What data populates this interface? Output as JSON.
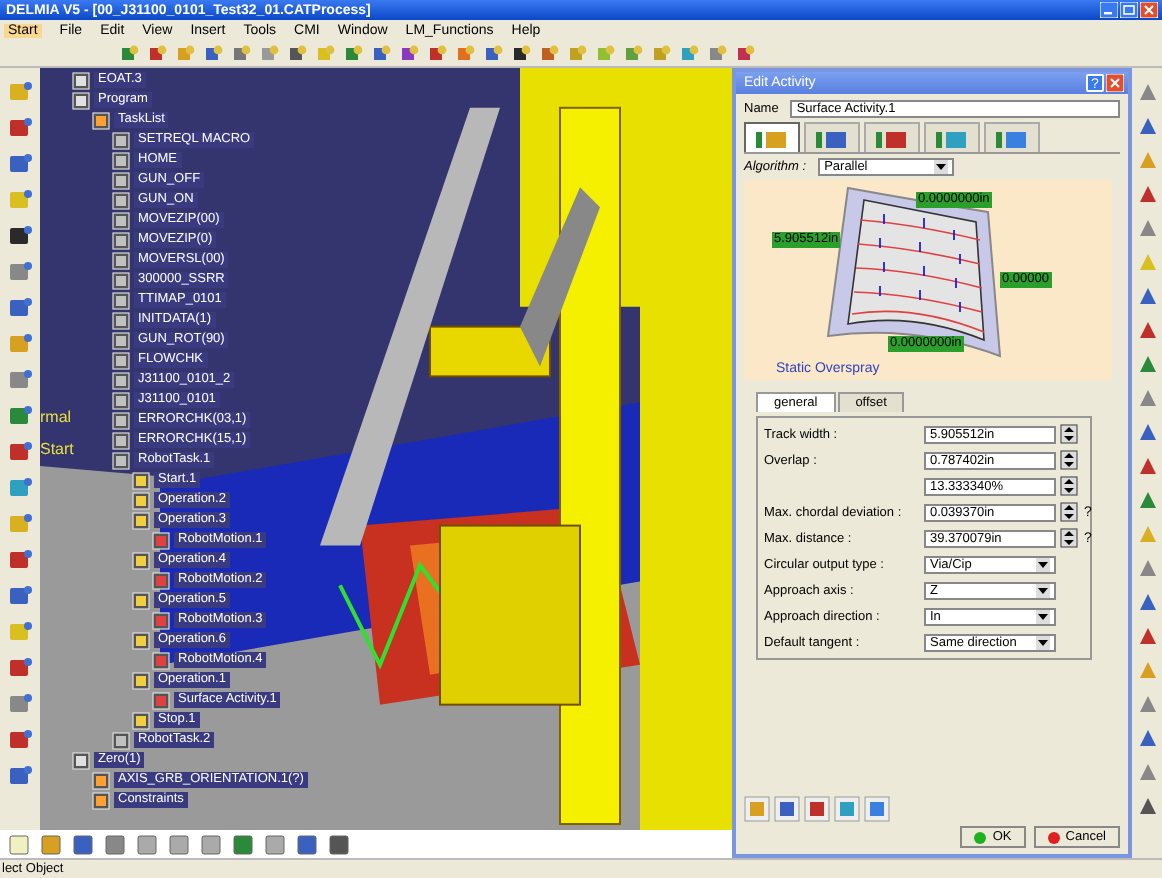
{
  "window": {
    "title": "DELMIA V5 - [00_J31100_0101_Test32_01.CATProcess]"
  },
  "menu": [
    {
      "label": "Start",
      "selected": true
    },
    {
      "label": "File",
      "selected": false
    },
    {
      "label": "Edit",
      "selected": false
    },
    {
      "label": "View",
      "selected": false
    },
    {
      "label": "Insert",
      "selected": false
    },
    {
      "label": "Tools",
      "selected": false
    },
    {
      "label": "CMI",
      "selected": false
    },
    {
      "label": "Window",
      "selected": false
    },
    {
      "label": "LM_Functions",
      "selected": false
    },
    {
      "label": "Help",
      "selected": false
    }
  ],
  "viewport_labels": [
    {
      "text": "rmal"
    },
    {
      "text": "Start"
    }
  ],
  "tree": [
    {
      "label": "EOAT.3"
    },
    {
      "label": "Program",
      "children": [
        {
          "label": "TaskList",
          "children": [
            {
              "label": "SETREQL MACRO"
            },
            {
              "label": "HOME"
            },
            {
              "label": "GUN_OFF"
            },
            {
              "label": "GUN_ON"
            },
            {
              "label": "MOVEZIP(00)"
            },
            {
              "label": "MOVEZIP(0)"
            },
            {
              "label": "MOVERSL(00)"
            },
            {
              "label": "300000_SSRR"
            },
            {
              "label": "TTIMAP_0101"
            },
            {
              "label": "INITDATA(1)"
            },
            {
              "label": "GUN_ROT(90)"
            },
            {
              "label": "FLOWCHK"
            },
            {
              "label": "J31100_0101_2"
            },
            {
              "label": "J31100_0101"
            },
            {
              "label": "ERRORCHK(03,1)"
            },
            {
              "label": "ERRORCHK(15,1)"
            },
            {
              "label": "RobotTask.1",
              "children": [
                {
                  "label": "Start.1"
                },
                {
                  "label": "Operation.2"
                },
                {
                  "label": "Operation.3",
                  "children": [
                    {
                      "label": "RobotMotion.1"
                    }
                  ]
                },
                {
                  "label": "Operation.4",
                  "children": [
                    {
                      "label": "RobotMotion.2"
                    }
                  ]
                },
                {
                  "label": "Operation.5",
                  "children": [
                    {
                      "label": "RobotMotion.3"
                    }
                  ]
                },
                {
                  "label": "Operation.6",
                  "children": [
                    {
                      "label": "RobotMotion.4"
                    }
                  ]
                },
                {
                  "label": "Operation.1",
                  "children": [
                    {
                      "label": "Surface Activity.1"
                    }
                  ]
                },
                {
                  "label": "Stop.1"
                }
              ]
            },
            {
              "label": "RobotTask.2"
            }
          ]
        }
      ]
    },
    {
      "label": "Zero(1)",
      "children": [
        {
          "label": "AXIS_GRB_ORIENTATION.1(?)"
        },
        {
          "label": "Constraints"
        }
      ]
    }
  ],
  "dialog": {
    "title": "Edit Activity",
    "help_button": "?",
    "name_label": "Name",
    "name_value": "Surface Activity.1",
    "icon_tabs": [
      {
        "selected": true
      },
      {
        "selected": false
      },
      {
        "selected": false
      },
      {
        "selected": false
      },
      {
        "selected": false
      }
    ],
    "algorithm_label": "Algorithm :",
    "algorithm_value": "Parallel",
    "diagram_labels": [
      "0.0000000in",
      "5.905512in",
      "0.00000",
      "0.0000000in"
    ],
    "diagram_caption": "Static Overspray",
    "tabs": [
      {
        "label": "general",
        "selected": true
      },
      {
        "label": "offset",
        "selected": false
      }
    ],
    "fields": [
      {
        "kind": "spin",
        "label": "Track width :",
        "value": "5.905512in"
      },
      {
        "kind": "spin",
        "label": "Overlap :",
        "value": "0.787402in"
      },
      {
        "kind": "spin",
        "value": "13.333340%"
      },
      {
        "kind": "spin",
        "label": "Max. chordal deviation :",
        "value": "0.039370in",
        "help": "?"
      },
      {
        "kind": "spin",
        "label": "Max. distance :",
        "value": "39.370079in",
        "help": "?"
      },
      {
        "kind": "select",
        "label": "Circular output type :",
        "value": "Via/Cip"
      },
      {
        "kind": "select",
        "label": "Approach axis :",
        "value": "Z"
      },
      {
        "kind": "select",
        "label": "Approach direction :",
        "value": "In"
      },
      {
        "kind": "select",
        "label": "Default tangent :",
        "value": "Same direction"
      }
    ],
    "ok": "OK",
    "cancel": "Cancel"
  },
  "status_bar": "lect Object"
}
